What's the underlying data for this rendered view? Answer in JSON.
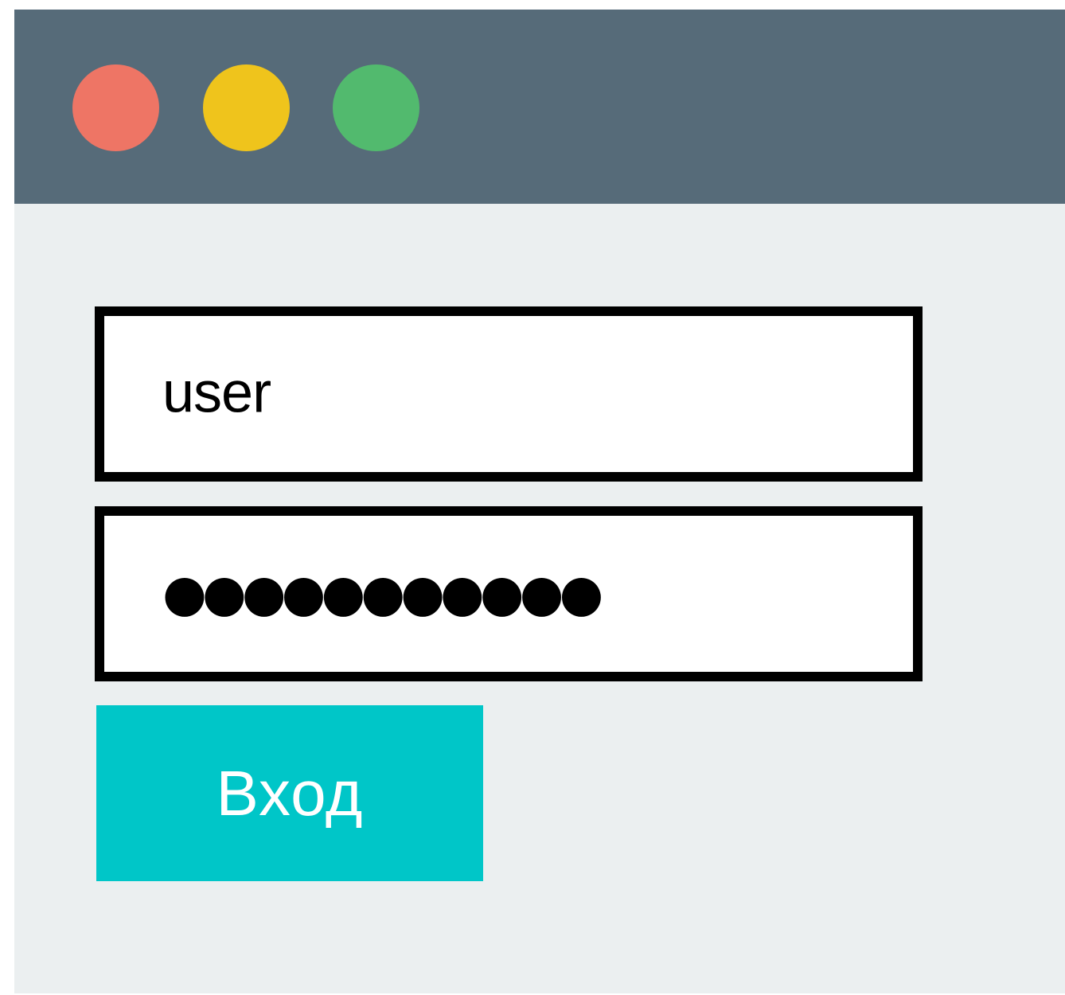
{
  "colors": {
    "titlebar": "#566b79",
    "content_bg": "#ebeff0",
    "close": "#ee7565",
    "minimize": "#efc41c",
    "maximize": "#52ba6e",
    "field_border": "#000000",
    "button_bg": "#00c6c8",
    "button_text": "#ffffff"
  },
  "window_controls": [
    {
      "name": "close",
      "color": "#ee7565"
    },
    {
      "name": "minimize",
      "color": "#efc41c"
    },
    {
      "name": "maximize",
      "color": "#52ba6e"
    }
  ],
  "form": {
    "username_value": "user",
    "password_value": "●●●●●●●●●●●",
    "login_label": "Вход"
  }
}
